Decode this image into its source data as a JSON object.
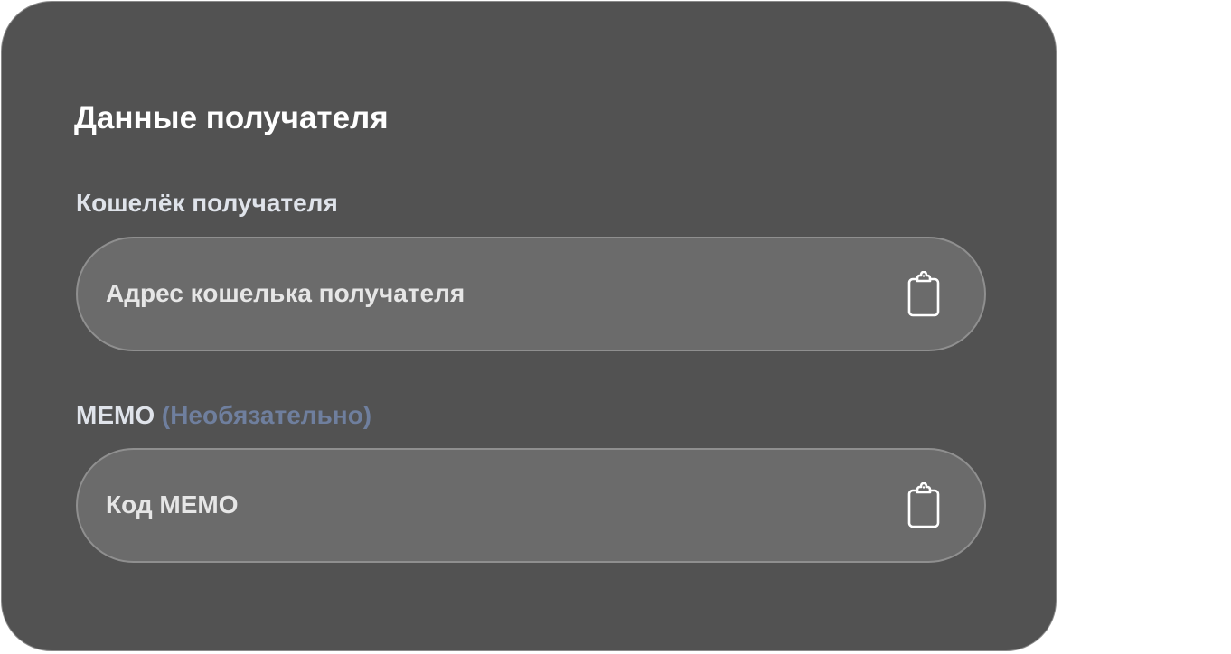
{
  "recipient_section": {
    "title": "Данные получателя",
    "wallet": {
      "label": "Кошелёк получателя",
      "placeholder": "Адрес кошелька получателя",
      "value": "",
      "paste_icon": "clipboard-icon"
    },
    "memo": {
      "label": "MEMO",
      "optional_note": "(Необязательно)",
      "placeholder": "Код MEMO",
      "value": "",
      "paste_icon": "clipboard-icon"
    }
  },
  "colors": {
    "card_background": "#525252",
    "field_background": "#6b6b6b",
    "optional_note": "#6f7f9e",
    "title_text": "#ffffff"
  }
}
